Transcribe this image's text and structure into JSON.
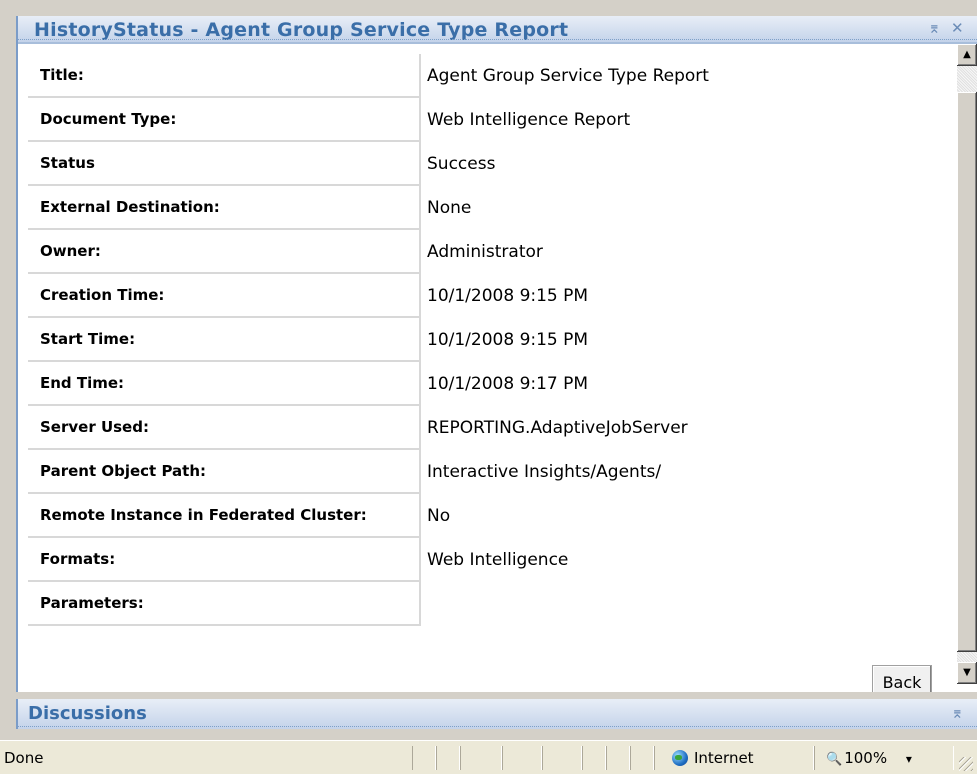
{
  "history_panel": {
    "title": "HistoryStatus - Agent Group Service Type Report",
    "pin_icon": "⌆",
    "close_icon": "✕"
  },
  "properties": [
    {
      "label": "Title:",
      "value": "Agent Group Service Type Report"
    },
    {
      "label": "Document Type:",
      "value": "Web Intelligence Report"
    },
    {
      "label": "Status",
      "value": "Success"
    },
    {
      "label": "External Destination:",
      "value": "None"
    },
    {
      "label": "Owner:",
      "value": "Administrator"
    },
    {
      "label": "Creation Time:",
      "value": "10/1/2008 9:15 PM"
    },
    {
      "label": "Start Time:",
      "value": "10/1/2008 9:15 PM"
    },
    {
      "label": "End Time:",
      "value": "10/1/2008 9:17 PM"
    },
    {
      "label": "Server Used:",
      "value": "REPORTING.AdaptiveJobServer"
    },
    {
      "label": "Parent Object Path:",
      "value": "Interactive Insights/Agents/"
    },
    {
      "label": "Remote Instance in Federated Cluster:",
      "value": "No"
    },
    {
      "label": "Formats:",
      "value": "Web Intelligence"
    },
    {
      "label": "Parameters:",
      "value": ""
    }
  ],
  "buttons": {
    "back": "Back"
  },
  "discussions_panel": {
    "title": "Discussions",
    "pin_icon": "⌆"
  },
  "status_bar": {
    "text": "Done",
    "zone": "Internet",
    "zoom": "100%",
    "zoom_arrow": "▾"
  },
  "colors": {
    "panel_title": "#3a6ea8",
    "header_bg": "#c4d3ea"
  }
}
